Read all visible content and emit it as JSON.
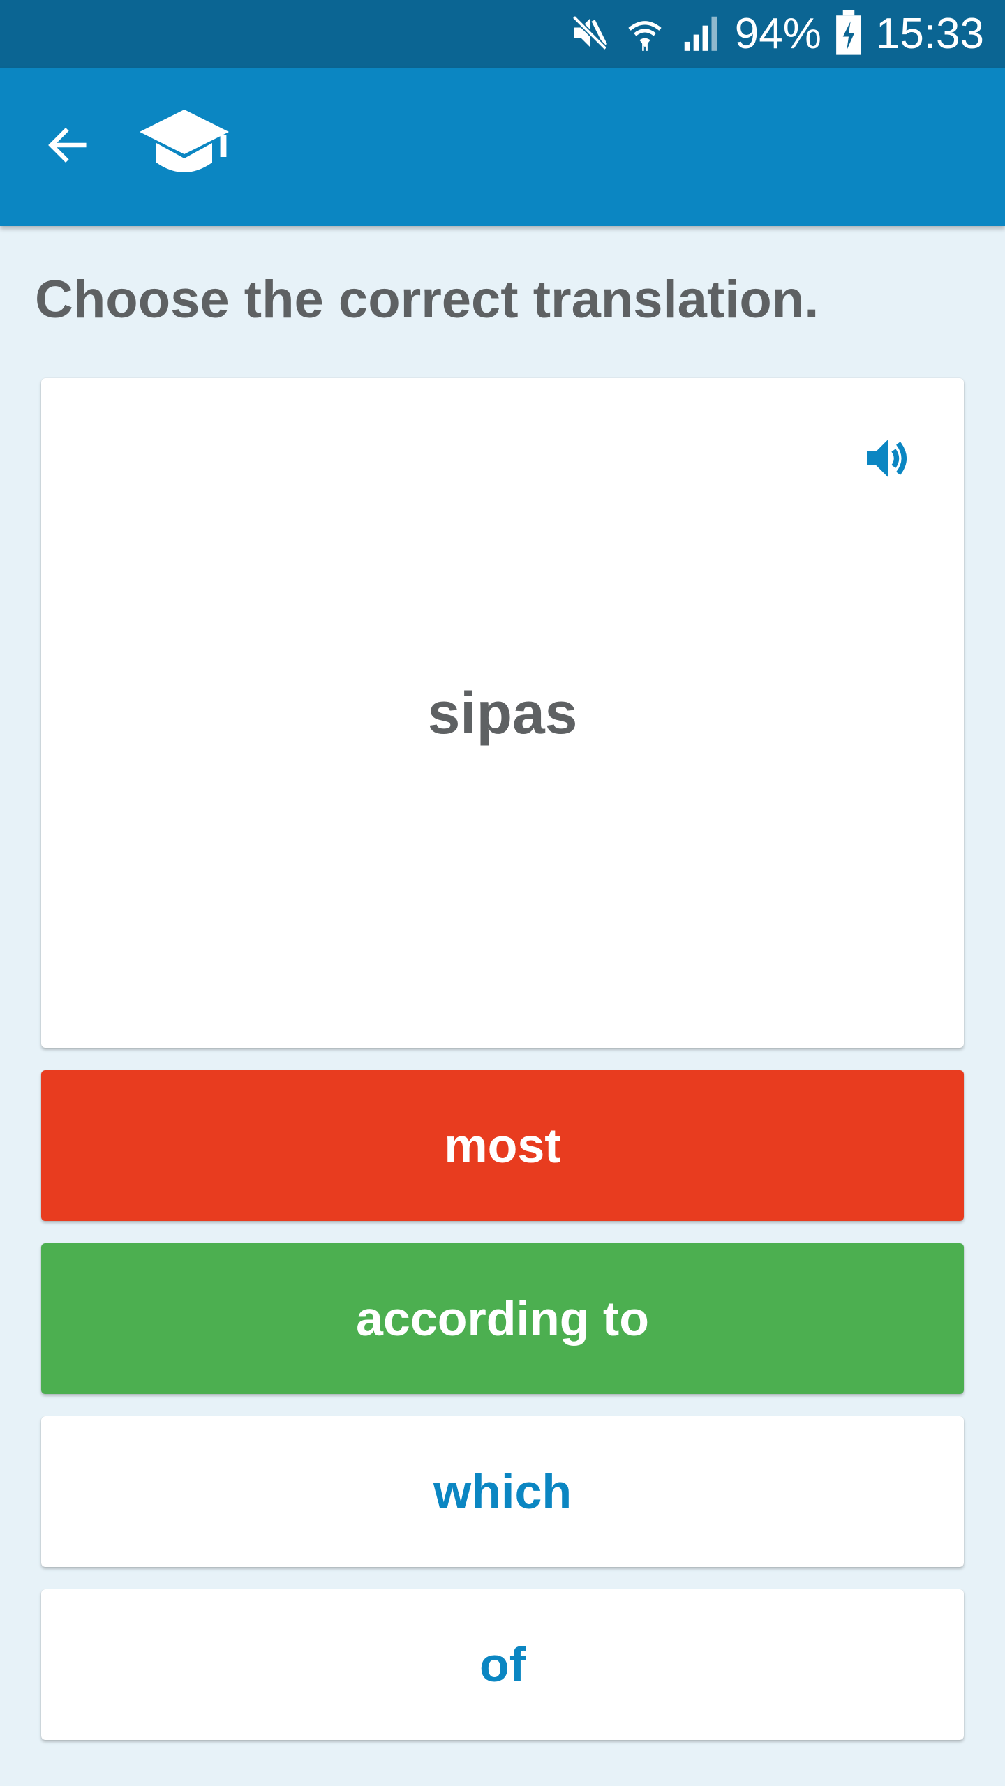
{
  "status_bar": {
    "battery": "94%",
    "time": "15:33",
    "icons": [
      "mute-icon",
      "wifi-icon",
      "signal-icon",
      "battery-charging-icon"
    ]
  },
  "app_bar": {
    "back_icon": "arrow-left-icon",
    "logo_icon": "graduation-cap-icon"
  },
  "exercise": {
    "instruction": "Choose the correct translation.",
    "word": "sipas",
    "audio_icon": "speaker-icon",
    "options": [
      {
        "label": "most",
        "state": "wrong"
      },
      {
        "label": "according to",
        "state": "correct"
      },
      {
        "label": "which",
        "state": "default"
      },
      {
        "label": "of",
        "state": "default"
      }
    ]
  },
  "colors": {
    "status_bar": "#0b6593",
    "app_bar": "#0b86c2",
    "background": "#e7f2f8",
    "wrong": "#e83c1f",
    "correct": "#4caf50",
    "option_text": "#0b86c2",
    "heading_text": "#5e6163"
  }
}
